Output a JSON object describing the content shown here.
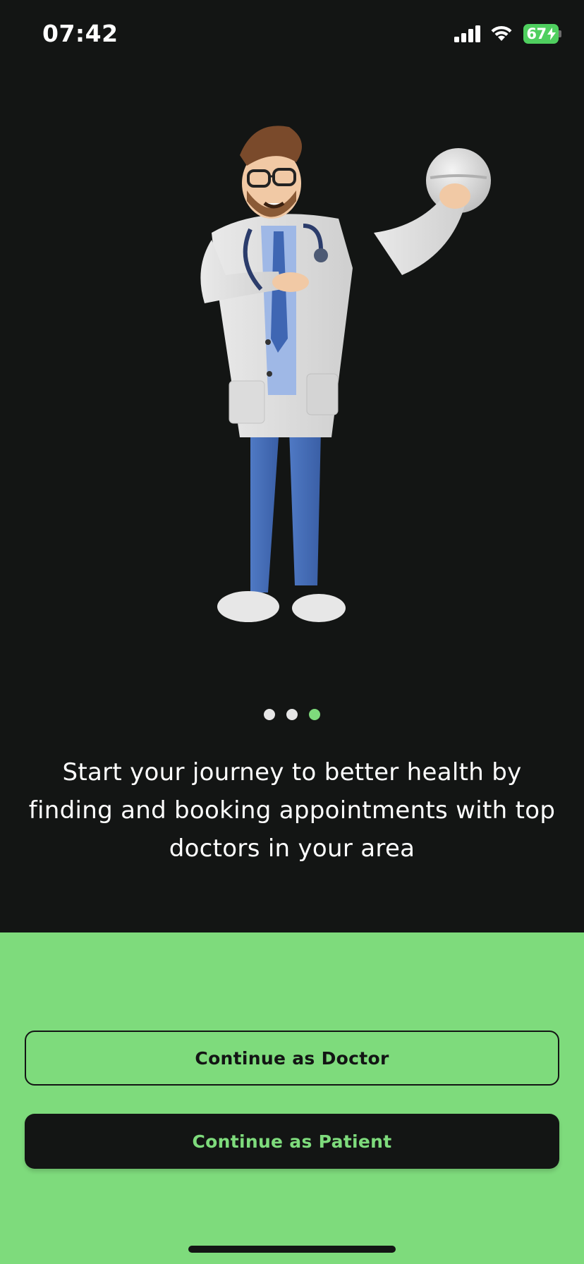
{
  "status_bar": {
    "time": "07:42",
    "battery_percent": "67",
    "icons": [
      "signal-icon",
      "wifi-icon",
      "battery-charging-icon"
    ]
  },
  "onboarding": {
    "illustration": "doctor-holding-pill-illustration",
    "pager": {
      "total": 3,
      "active_index": 2
    },
    "tagline": "Start your journey to better health by finding and booking appointments with top doctors in your area"
  },
  "actions": {
    "doctor_label": "Continue as Doctor",
    "patient_label": "Continue as Patient"
  },
  "colors": {
    "background": "#131514",
    "accent": "#7edb7c",
    "text_light": "#ffffff"
  }
}
